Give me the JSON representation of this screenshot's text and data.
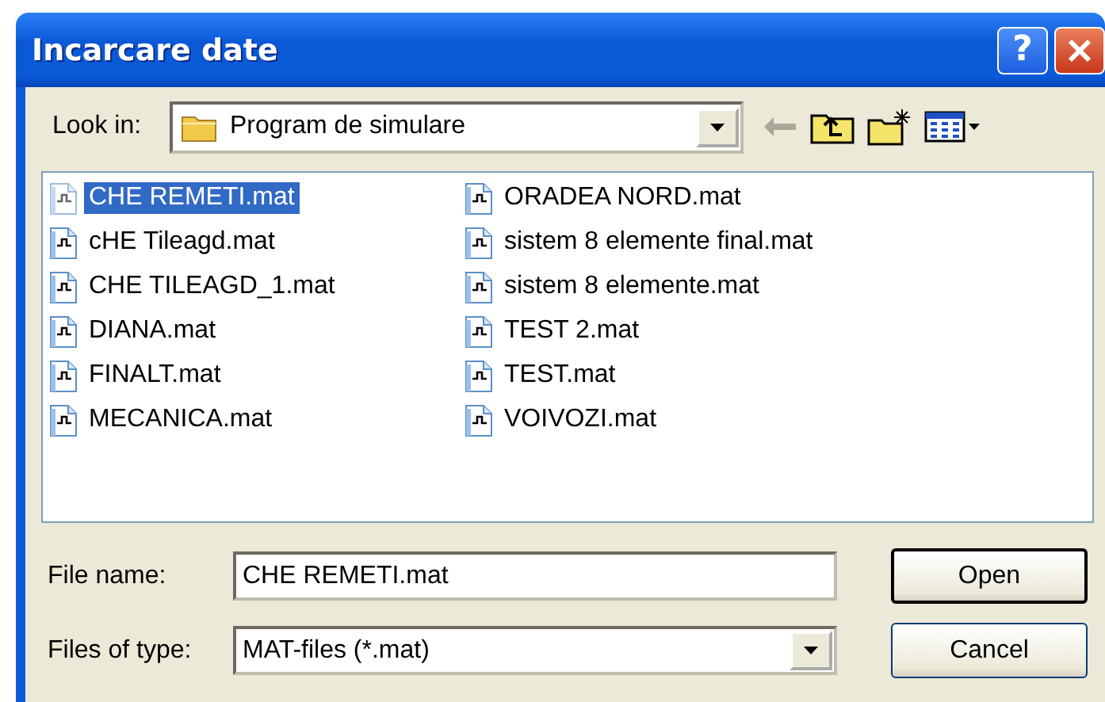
{
  "window": {
    "title": "Incarcare date",
    "help_button": "?"
  },
  "look_in": {
    "label": "Look in:",
    "value": "Program de simulare"
  },
  "toolbar": [
    {
      "kind": "back",
      "disabled": true
    },
    {
      "kind": "up",
      "disabled": false
    },
    {
      "kind": "new_folder",
      "disabled": false
    },
    {
      "kind": "view_menu",
      "disabled": false
    }
  ],
  "files": [
    {
      "name": "CHE REMETI.mat",
      "selected": true
    },
    {
      "name": "cHE Tileagd.mat",
      "selected": false
    },
    {
      "name": "CHE TILEAGD_1.mat",
      "selected": false
    },
    {
      "name": "DIANA.mat",
      "selected": false
    },
    {
      "name": "FINALT.mat",
      "selected": false
    },
    {
      "name": "MECANICA.mat",
      "selected": false
    },
    {
      "name": "ORADEA NORD.mat",
      "selected": false
    },
    {
      "name": "sistem 8 elemente final.mat",
      "selected": false
    },
    {
      "name": "sistem 8 elemente.mat",
      "selected": false
    },
    {
      "name": "TEST 2.mat",
      "selected": false
    },
    {
      "name": "TEST.mat",
      "selected": false
    },
    {
      "name": "VOIVOZI.mat",
      "selected": false
    }
  ],
  "file_name": {
    "label": "File name:",
    "value": "CHE REMETI.mat"
  },
  "files_of_type": {
    "label": "Files of type:",
    "value": "MAT-files (*.mat)"
  },
  "buttons": [
    {
      "label": "Open",
      "default": true
    },
    {
      "label": "Cancel",
      "default": false
    }
  ]
}
